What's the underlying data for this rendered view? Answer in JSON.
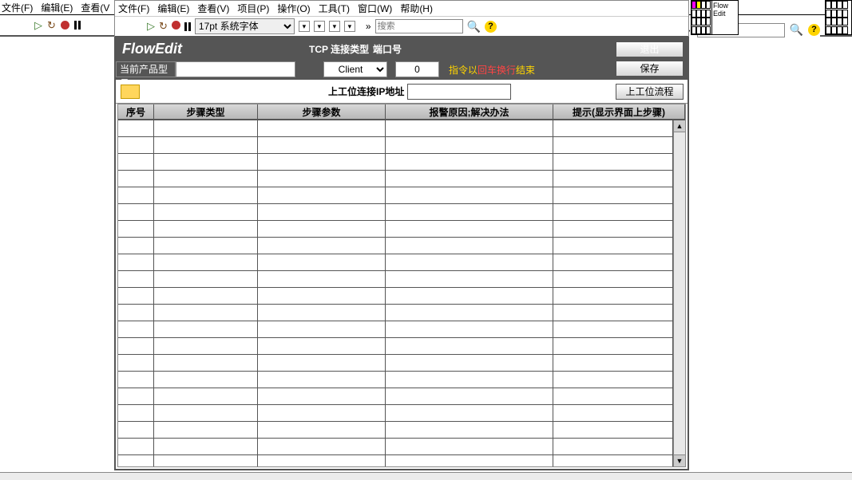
{
  "outer_menu": {
    "file": "文件(F)",
    "edit": "编辑(E)",
    "view": "查看(V"
  },
  "inner_menu": {
    "file": "文件(F)",
    "edit": "编辑(E)",
    "view": "查看(V)",
    "project": "项目(P)",
    "operate": "操作(O)",
    "tool": "工具(T)",
    "window": "窗口(W)",
    "help": "帮助(H)"
  },
  "font_select": "17pt 系统字体",
  "search_placeholder": "搜索",
  "palette_label": "Flow Edit",
  "app": {
    "title": "FlowEdit",
    "tcp_label": "TCP 连接类型",
    "port_label": "端口号",
    "exit": "退出",
    "save": "保存",
    "product_label": "当前产品型号",
    "product_value": "",
    "tcp_value": "Client",
    "port_value": "0",
    "warn_prefix": "指令以",
    "warn_mid": "回车换行",
    "warn_suffix": "结束",
    "ip_label": "上工位连接IP地址",
    "ip_value": "",
    "flow_btn": "上工位流程"
  },
  "columns": {
    "seq": "序号",
    "type": "步骤类型",
    "param": "步骤参数",
    "alarm": "报警原因;解决办法",
    "hint": "提示(显示界面上步骤)"
  },
  "row_count": 21,
  "icons": {
    "run": "▷",
    "load": "↻",
    "drop": "▾",
    "mag": "🔍",
    "help": "?"
  }
}
